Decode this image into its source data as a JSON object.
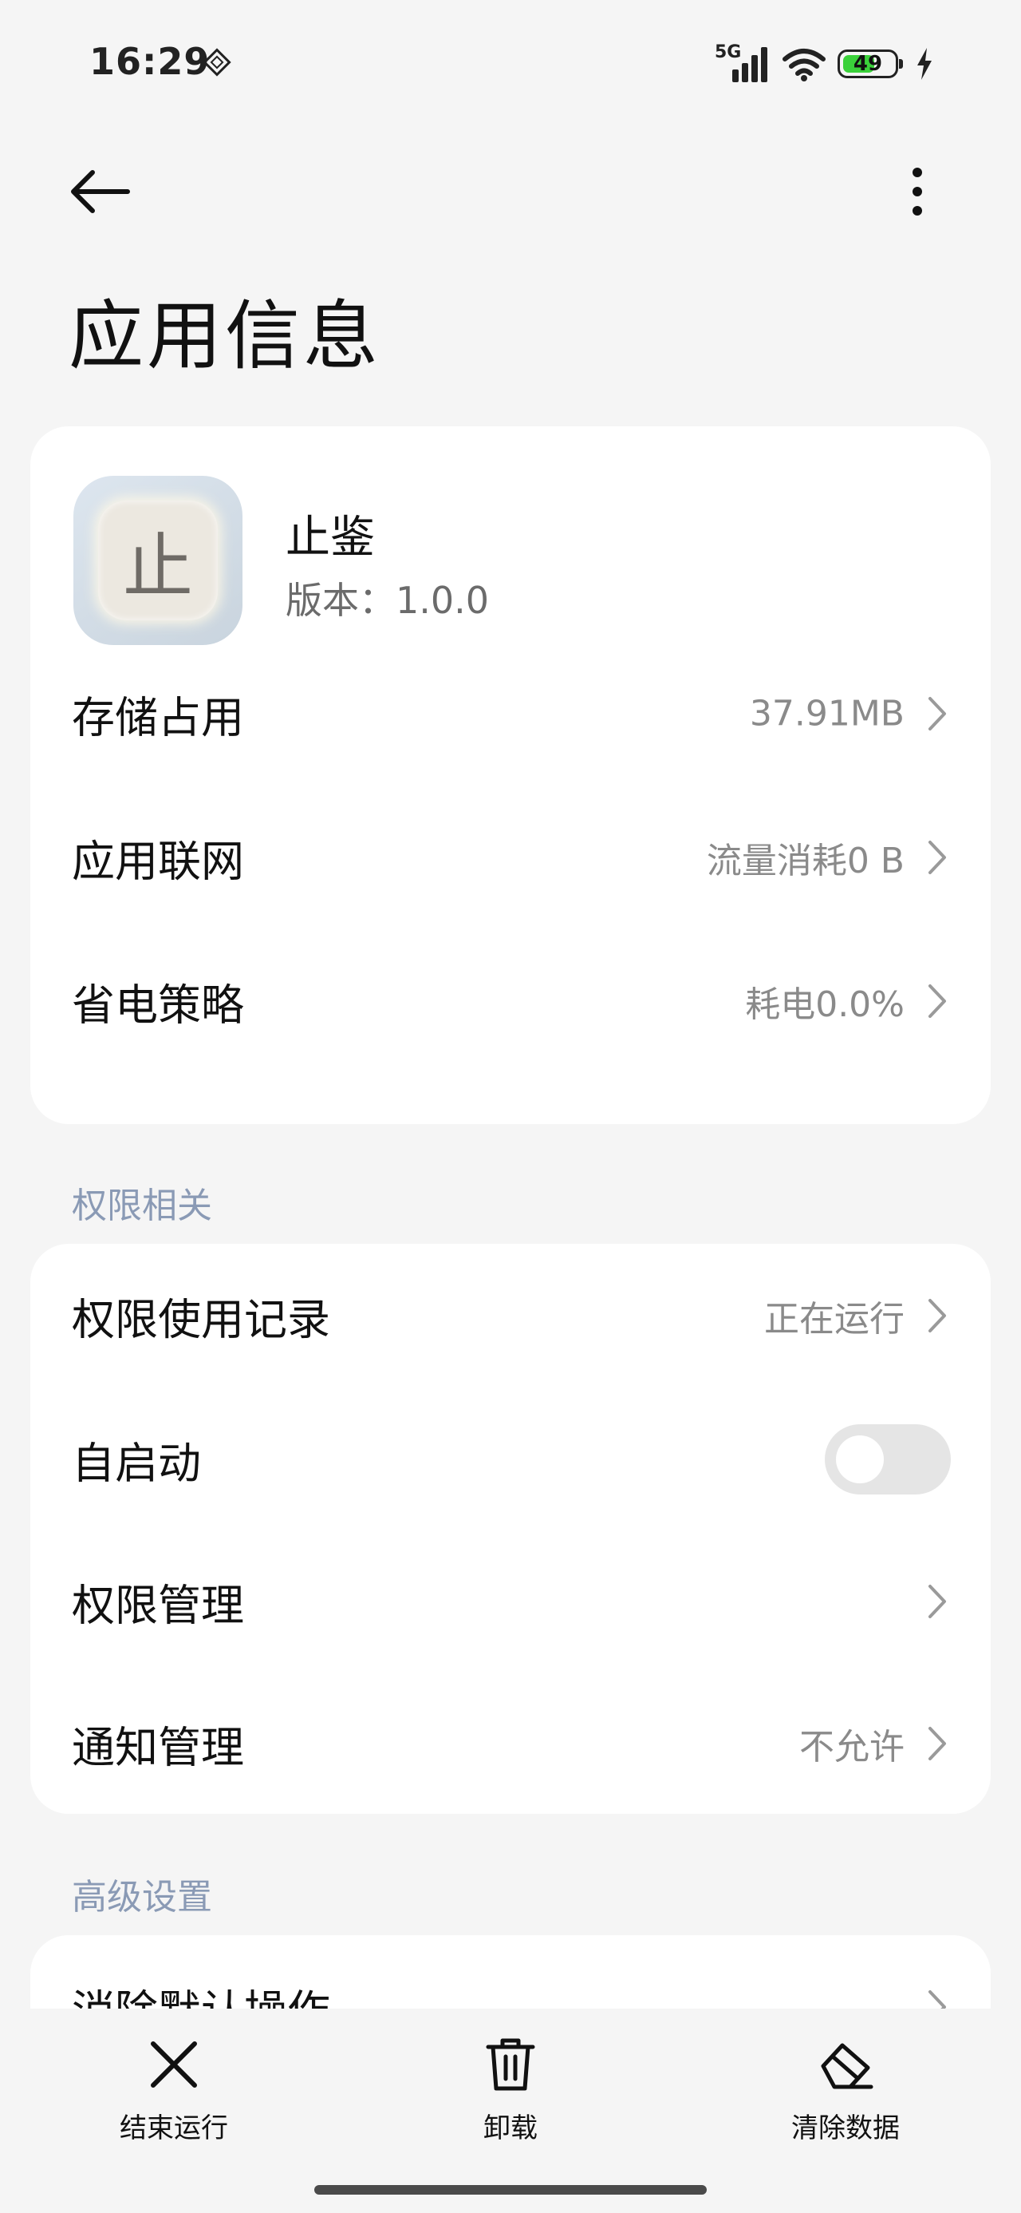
{
  "status_bar": {
    "time": "16:29",
    "network": "5G",
    "battery": "49"
  },
  "header": {
    "title": "应用信息"
  },
  "app": {
    "name": "止鉴",
    "icon_glyph": "止",
    "version": "版本：1.0.0"
  },
  "app_rows": [
    {
      "label": "存储占用",
      "value": "37.91MB"
    },
    {
      "label": "应用联网",
      "value": "流量消耗0 B"
    },
    {
      "label": "省电策略",
      "value": "耗电0.0%"
    }
  ],
  "sections": {
    "permissions": "权限相关",
    "advanced": "高级设置"
  },
  "perm_rows": [
    {
      "label": "权限使用记录",
      "value": "正在运行"
    },
    {
      "label": "自启动",
      "value": "",
      "toggle_on": false
    },
    {
      "label": "权限管理",
      "value": ""
    },
    {
      "label": "通知管理",
      "value": "不允许"
    }
  ],
  "adv_rows": [
    {
      "label": "消除默认操作",
      "value": ""
    }
  ],
  "bottom_bar": [
    {
      "label": "结束运行",
      "icon": "close-icon"
    },
    {
      "label": "卸载",
      "icon": "trash-icon"
    },
    {
      "label": "清除数据",
      "icon": "eraser-icon"
    }
  ],
  "colors": {
    "accent_section": "#8a9ab5",
    "value_gray": "#8a8a8a",
    "toggle_off": "#e5e5e5"
  }
}
